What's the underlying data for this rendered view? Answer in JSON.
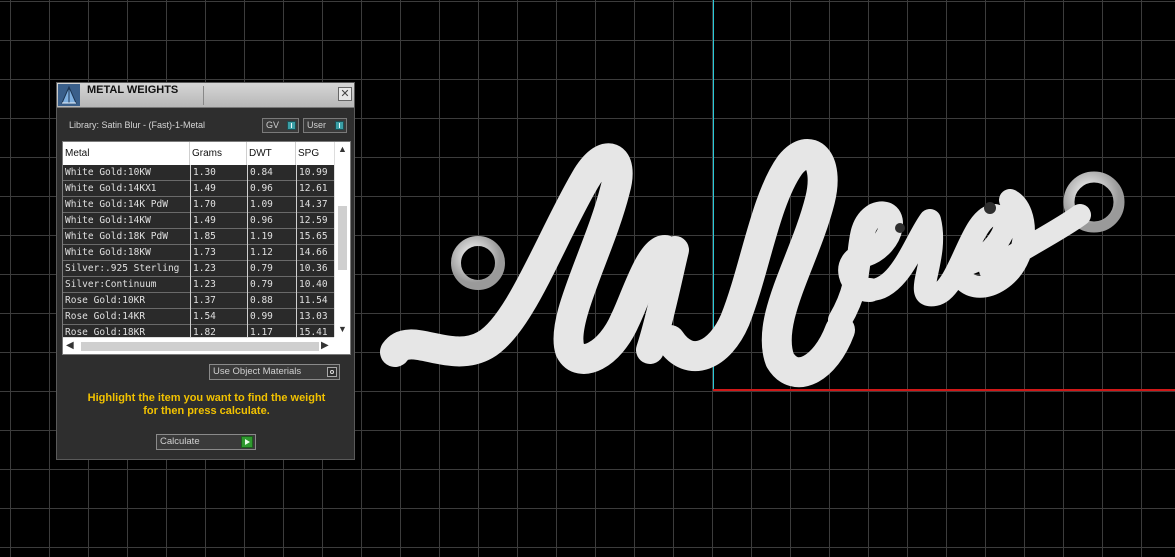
{
  "panel": {
    "title": "METAL WEIGHTS",
    "close_glyph": "✕",
    "library_label": "Library: Satin Blur - (Fast)-1-Metal",
    "gv_button": "GV",
    "user_button": "User",
    "use_object_materials": "Use Object Materials",
    "instructions_line1": "Highlight the item you want to find the weight",
    "instructions_line2": "for then press calculate.",
    "calculate_button": "Calculate",
    "table": {
      "columns": [
        "Metal",
        "Grams",
        "DWT",
        "SPG"
      ],
      "rows": [
        [
          "White Gold:10KW",
          "1.30",
          "0.84",
          "10.99"
        ],
        [
          "White Gold:14KX1",
          "1.49",
          "0.96",
          "12.61"
        ],
        [
          "White Gold:14K PdW",
          "1.70",
          "1.09",
          "14.37"
        ],
        [
          "White Gold:14KW",
          "1.49",
          "0.96",
          "12.59"
        ],
        [
          "White Gold:18K PdW",
          "1.85",
          "1.19",
          "15.65"
        ],
        [
          "White Gold:18KW",
          "1.73",
          "1.12",
          "14.66"
        ],
        [
          "Silver:.925 Sterling",
          "1.23",
          "0.79",
          "10.36"
        ],
        [
          "Silver:Continuum",
          "1.23",
          "0.79",
          "10.40"
        ],
        [
          "Rose Gold:10KR",
          "1.37",
          "0.88",
          "11.54"
        ],
        [
          "Rose Gold:14KR",
          "1.54",
          "0.99",
          "13.03"
        ],
        [
          "Rose Gold:18KR",
          "1.82",
          "1.17",
          "15.41"
        ]
      ]
    }
  },
  "icons": {
    "app": "metal-weights-app-icon",
    "close": "close-icon",
    "scroll_up": "▲",
    "scroll_down": "▼",
    "scroll_left": "◀",
    "scroll_right": "▶"
  },
  "colors": {
    "background": "#000000",
    "grid": "#3c3c3c",
    "axis_y": "#29c9d8",
    "axis_x": "#d01818",
    "instruction_text": "#f2c200",
    "model_fill": "#e6e6e6"
  }
}
